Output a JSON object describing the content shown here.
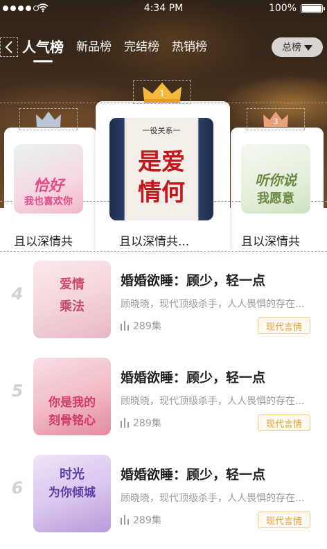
{
  "status_bar": {
    "time": "4:34 PM",
    "battery": "100%"
  },
  "nav": {
    "tabs": [
      {
        "label": "人气榜"
      },
      {
        "label": "新品榜"
      },
      {
        "label": "完结榜"
      },
      {
        "label": "热销榜"
      }
    ],
    "filter_label": "总榜"
  },
  "podium": {
    "first": {
      "rank": "1",
      "title": "且以深情共...",
      "cover_text_top": "是爱",
      "cover_text_bottom": "情何",
      "cover_caption": "一役关系一"
    },
    "second": {
      "title": "且以深情共",
      "cover_text_top": "恰好",
      "cover_text_bottom": "我也喜欢你"
    },
    "third": {
      "rank": "3",
      "title": "且以深情共",
      "cover_text_top": "听你说",
      "cover_text_bottom": "我愿意"
    }
  },
  "list": [
    {
      "rank": "4",
      "title": "婚婚欲睡：顾少，轻一点",
      "desc": "顾晓晓，现代顶级杀手，人人畏惧的存在...",
      "count": "289集",
      "tag": "现代言情",
      "cover_text_top": "爱情",
      "cover_text_bottom": "乘法",
      "cover_color": "#f4d6dc"
    },
    {
      "rank": "5",
      "title": "婚婚欲睡：顾少，轻一点",
      "desc": "顾晓晓，现代顶级杀手，人人畏惧的存在...",
      "count": "289集",
      "tag": "现代言情",
      "cover_text_top": "你是我的",
      "cover_text_bottom": "刻骨铭心",
      "cover_color": "#f1b9c4"
    },
    {
      "rank": "6",
      "title": "婚婚欲睡：顾少，轻一点",
      "desc": "顾晓晓，现代顶级杀手，人人畏惧的存在...",
      "count": "289集",
      "tag": "现代言情",
      "cover_text_top": "时光",
      "cover_text_bottom": "为你倾城",
      "cover_color": "#d8c3ee"
    }
  ],
  "colors": {
    "accent_gold": "#e0a23a",
    "crown_gold": "#f2b93b",
    "crown_silver": "#b9c6d8",
    "crown_bronze": "#e8a27a"
  },
  "icons": [
    "back-chevron-icon",
    "wifi-icon",
    "caret-down-icon",
    "crown-icon",
    "audio-bars-icon"
  ]
}
